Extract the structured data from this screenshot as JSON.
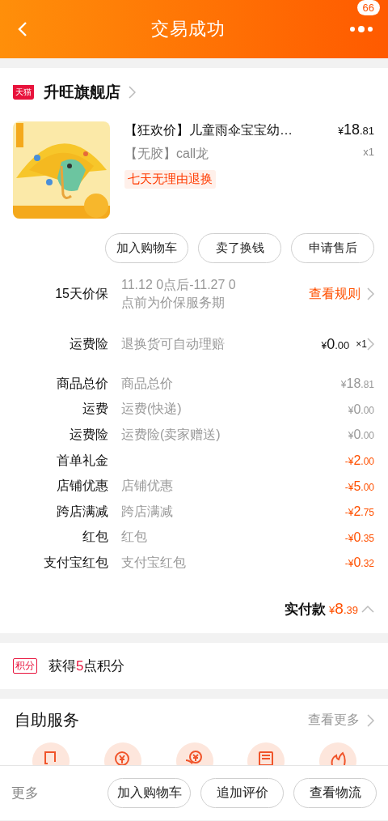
{
  "header": {
    "title": "交易成功",
    "badge": "66"
  },
  "store": {
    "badge": "天猫",
    "name": "升旺旗舰店"
  },
  "product": {
    "title": "【狂欢价】儿童雨伞宝宝幼…",
    "price": {
      "currency": "¥",
      "main": "18",
      "fraction": ".81"
    },
    "quantity": "x1",
    "sku": "【无胶】call龙",
    "tag": "七天无理由退换"
  },
  "item_actions": [
    "加入购物车",
    "卖了换钱",
    "申请售后"
  ],
  "services": [
    {
      "label": "15天价保",
      "description": "11.12 0点后-11.27 0\n点前为价保服务期",
      "link": "查看规则"
    },
    {
      "label": "运费险",
      "description": "退换货可自动理赔",
      "price": {
        "currency": "¥",
        "main": "0",
        "fraction": ".00"
      },
      "quantity": "×1"
    }
  ],
  "fees": [
    {
      "kind": "charge",
      "label": "商品总价",
      "description": "商品总价",
      "amount": {
        "currency": "¥",
        "main": "18",
        "fraction": ".81"
      }
    },
    {
      "kind": "charge",
      "label": "运费",
      "description": "运费(快递)",
      "amount": {
        "currency": "¥",
        "main": "0",
        "fraction": ".00"
      }
    },
    {
      "kind": "charge",
      "label": "运费险",
      "description": "运费险(卖家赠送)",
      "amount": {
        "currency": "¥",
        "main": "0",
        "fraction": ".00"
      }
    },
    {
      "kind": "discount",
      "label": "首单礼金",
      "amount": {
        "sign": "-",
        "currency": "¥",
        "main": "2",
        "fraction": ".00"
      }
    },
    {
      "kind": "discount",
      "label": "店铺优惠",
      "description": "店铺优惠",
      "amount": {
        "sign": "-",
        "currency": "¥",
        "main": "5",
        "fraction": ".00"
      }
    },
    {
      "kind": "discount",
      "label": "跨店满减",
      "description": "跨店满减",
      "amount": {
        "sign": "-",
        "currency": "¥",
        "main": "2",
        "fraction": ".75"
      }
    },
    {
      "kind": "discount",
      "label": "红包",
      "description": "红包",
      "amount": {
        "sign": "-",
        "currency": "¥",
        "main": "0",
        "fraction": ".35"
      }
    },
    {
      "kind": "discount",
      "label": "支付宝红包",
      "description": "支付宝红包",
      "amount": {
        "sign": "-",
        "currency": "¥",
        "main": "0",
        "fraction": ".32"
      }
    }
  ],
  "total": {
    "label": "实付款",
    "amount": {
      "currency": "¥",
      "main": "8",
      "fraction": ".39"
    },
    "expanded": true
  },
  "points": {
    "badge": "积分",
    "prefix": "获得",
    "value": "5",
    "suffix": "点积分"
  },
  "self_service": {
    "title": "自助服务",
    "more": "查看更多",
    "icons": [
      {
        "kind": "document"
      },
      {
        "kind": "coin"
      },
      {
        "kind": "coin-hand"
      },
      {
        "kind": "list"
      },
      {
        "kind": "flame"
      }
    ]
  },
  "bottom_bar": {
    "more": "更多",
    "buttons": [
      "加入购物车",
      "追加评价",
      "查看物流"
    ]
  }
}
